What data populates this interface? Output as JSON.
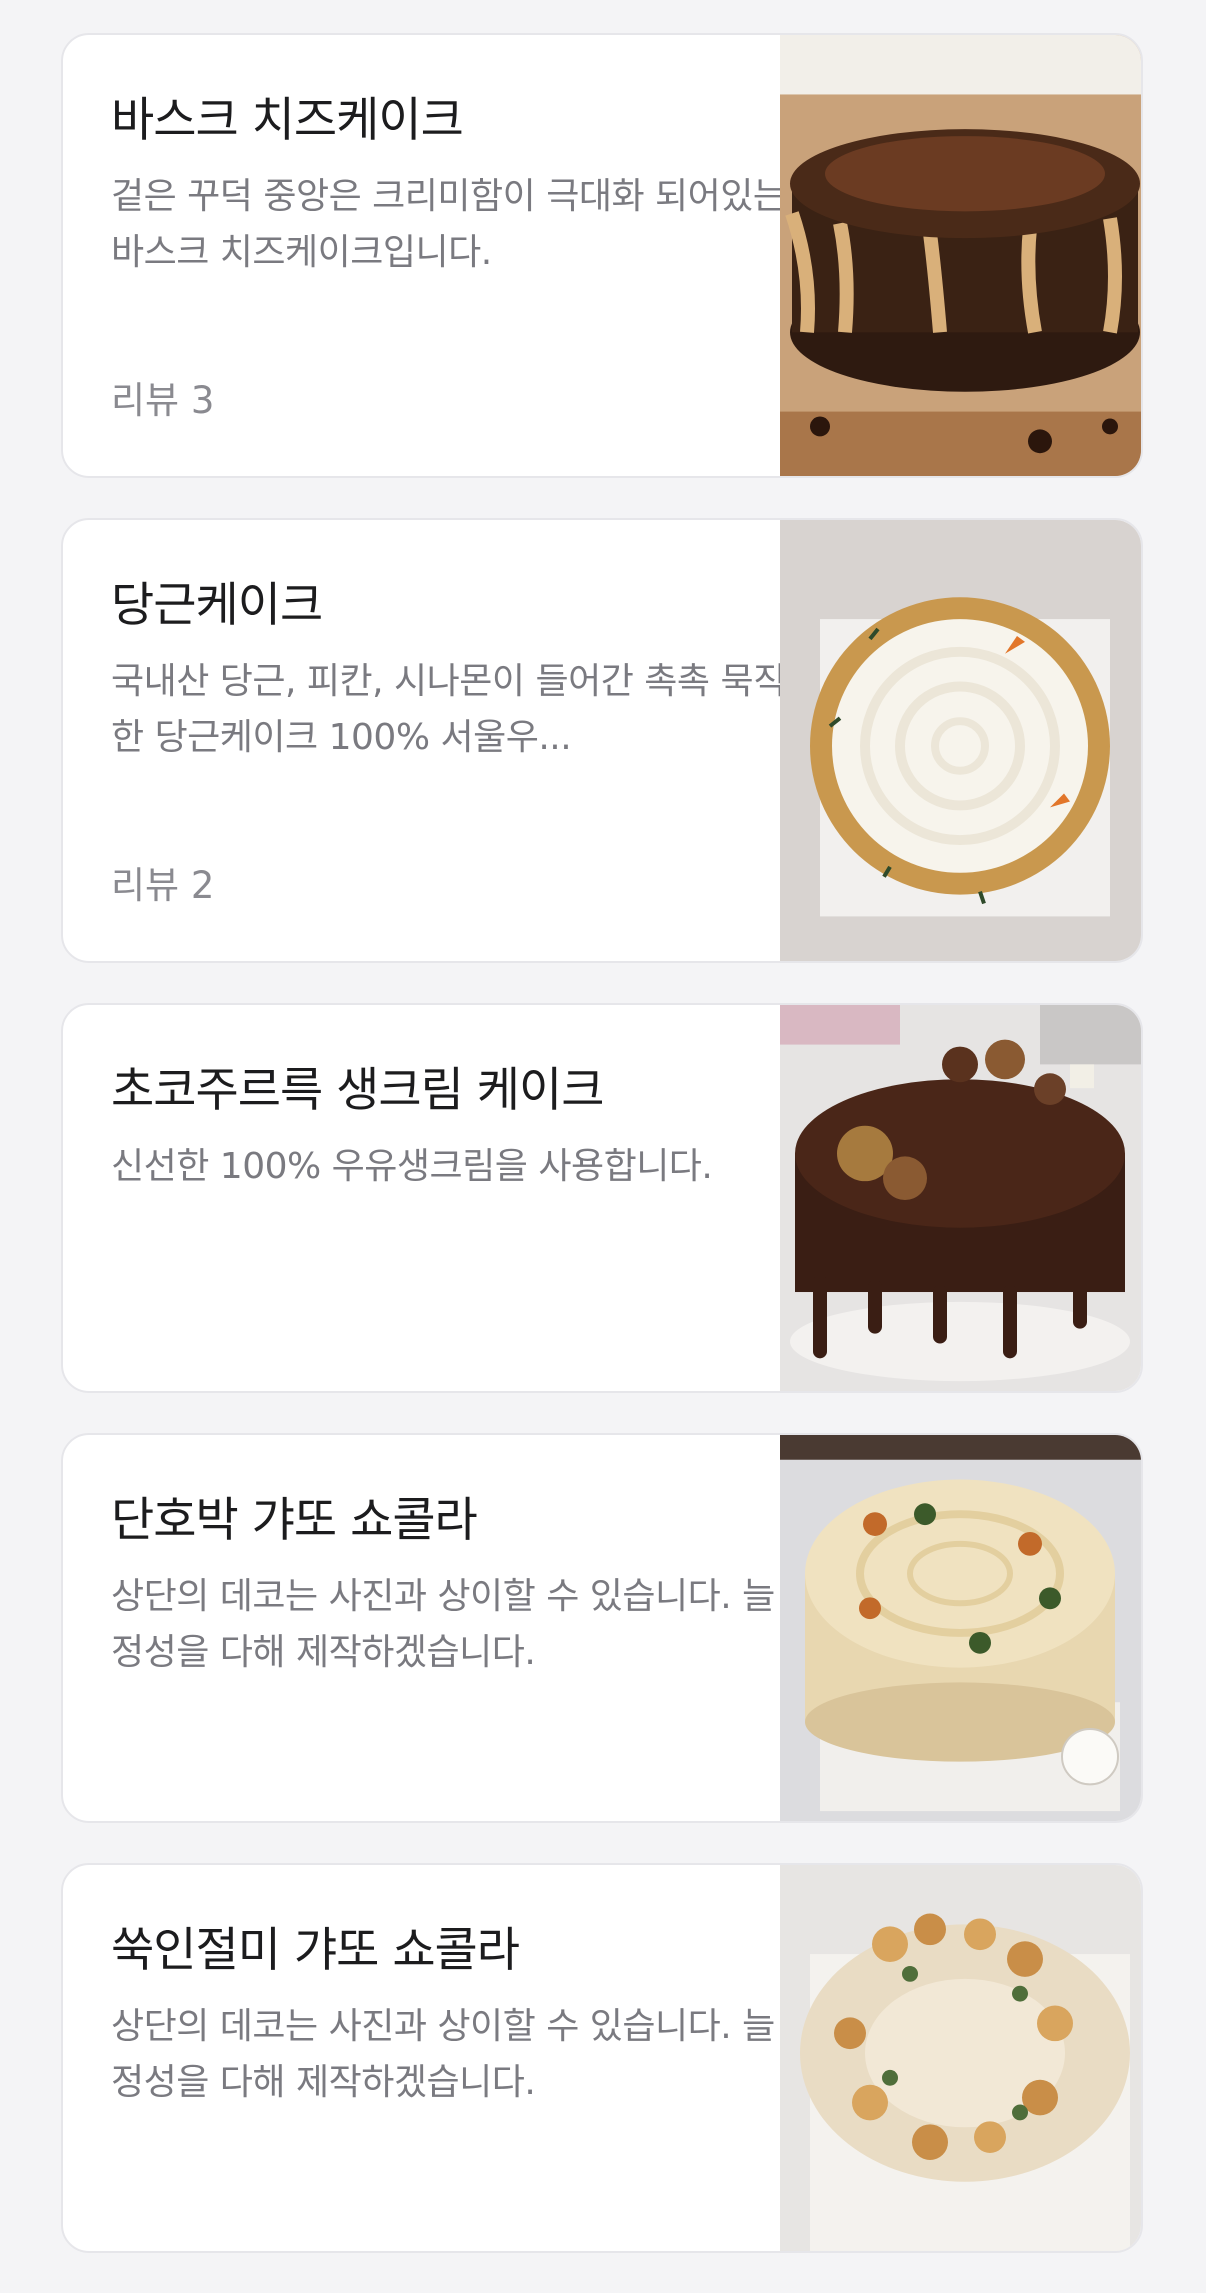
{
  "items": [
    {
      "title": "바스크 치즈케이크",
      "description": "겉은 꾸덕 중앙은 크리미함이 극대화 되어있는 바스크 치즈케이크입니다.",
      "review": "리뷰 3",
      "image": "basque-cheesecake-photo"
    },
    {
      "title": "당근케이크",
      "description": "국내산 당근, 피칸, 시나몬이 들어간 촉촉 묵직한 당근케이크 100% 서울우...",
      "review": "리뷰 2",
      "image": "carrot-cake-photo"
    },
    {
      "title": "초코주르륵 생크림 케이크",
      "description": "신선한 100% 우유생크림을 사용합니다.",
      "review": "",
      "image": "chocolate-drip-cake-photo"
    },
    {
      "title": "단호박 갸또 쇼콜라",
      "description": "상단의 데코는 사진과 상이할 수 있습니다. 늘 정성을 다해 제작하겠습니다.",
      "review": "",
      "image": "pumpkin-gateau-chocolat-photo"
    },
    {
      "title": "쑥인절미 갸또 쇼콜라",
      "description": "상단의 데코는 사진과 상이할 수 있습니다. 늘 정성을 다해 제작하겠습니다.",
      "review": "",
      "image": "mugwort-injeolmi-gateau-photo"
    }
  ]
}
